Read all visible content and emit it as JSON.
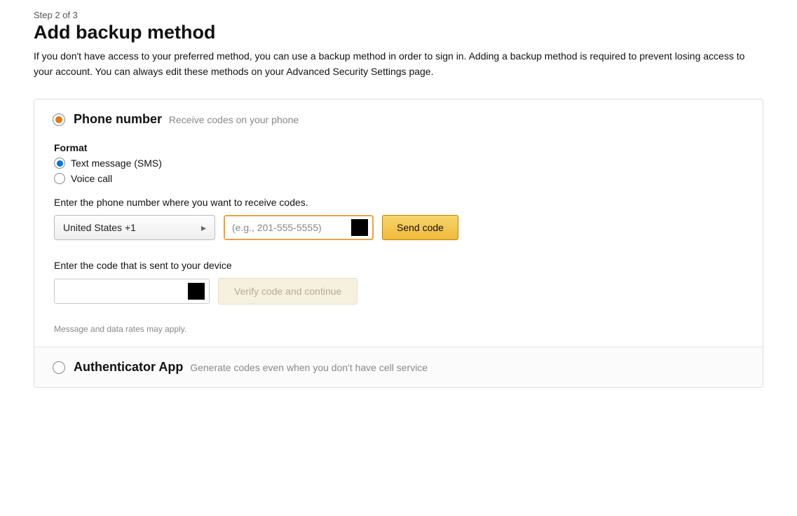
{
  "header": {
    "step": "Step 2 of 3",
    "title": "Add backup method",
    "intro": "If you don't have access to your preferred method, you can use a backup method in order to sign in. Adding a backup method is required to prevent losing access to your account. You can always edit these methods on your Advanced Security Settings page."
  },
  "phone": {
    "title": "Phone number",
    "subtitle": "Receive codes on your phone",
    "format_label": "Format",
    "options": {
      "sms": "Text message (SMS)",
      "voice": "Voice call"
    },
    "enter_number_prompt": "Enter the phone number where you want to receive codes.",
    "country_selected": "United States +1",
    "phone_placeholder": "(e.g., 201-555-5555)",
    "send_code_label": "Send code",
    "enter_code_prompt": "Enter the code that is sent to your device",
    "verify_label": "Verify code and continue",
    "fineprint": "Message and data rates may apply."
  },
  "authapp": {
    "title": "Authenticator App",
    "subtitle": "Generate codes even when you don't have cell service"
  }
}
